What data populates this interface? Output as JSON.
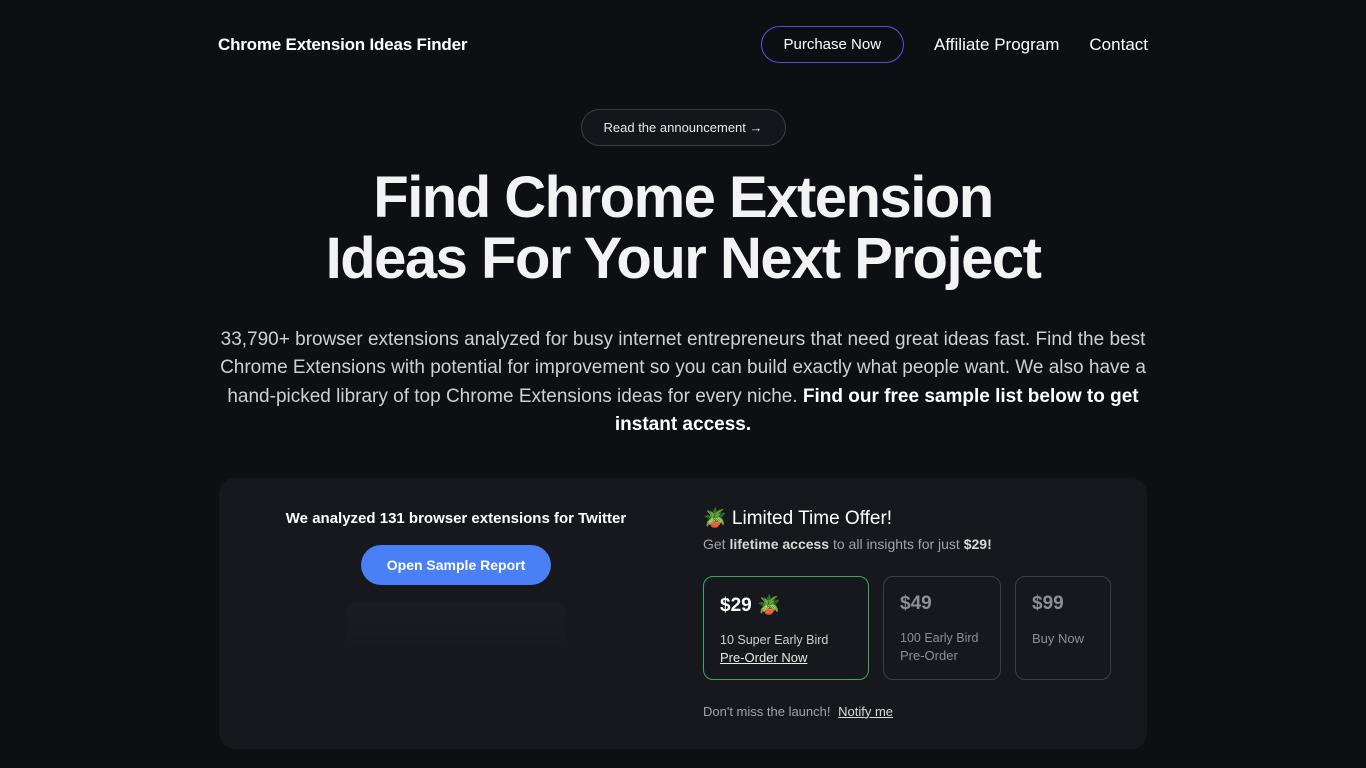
{
  "header": {
    "logo": "Chrome Extension Ideas Finder",
    "purchase_label": "Purchase Now",
    "affiliate_label": "Affiliate Program",
    "contact_label": "Contact"
  },
  "hero": {
    "announcement": "Read the announcement →",
    "title_line1": "Find Chrome Extension",
    "title_line2": "Ideas For Your Next Project",
    "sub_plain": "33,790+ browser extensions analyzed for busy internet entrepreneurs that need great ideas fast. Find the best Chrome Extensions with potential for improvement so you can build exactly what people want. We also have a hand-picked library of top Chrome Extensions ideas for every niche. ",
    "sub_bold": "Find our free sample list below to get instant access."
  },
  "sample": {
    "analyzed_text": "We analyzed 131 browser extensions for Twitter",
    "button_label": "Open Sample Report"
  },
  "offer": {
    "title": "🪴 Limited Time Offer!",
    "sub_prefix": "Get ",
    "sub_bold1": "lifetime access",
    "sub_mid": " to all insights for just ",
    "sub_bold2": "$29!",
    "tiers": [
      {
        "price": "$29 🪴",
        "line1": "10 Super Early Bird",
        "line2": "Pre-Order Now",
        "active": true
      },
      {
        "price": "$49",
        "line1": "100 Early Bird",
        "line2": "Pre-Order",
        "active": false
      },
      {
        "price": "$99",
        "line1": "",
        "line2": "Buy Now",
        "active": false
      }
    ],
    "notify_text": "Don't miss the launch!",
    "notify_link": "Notify me"
  }
}
